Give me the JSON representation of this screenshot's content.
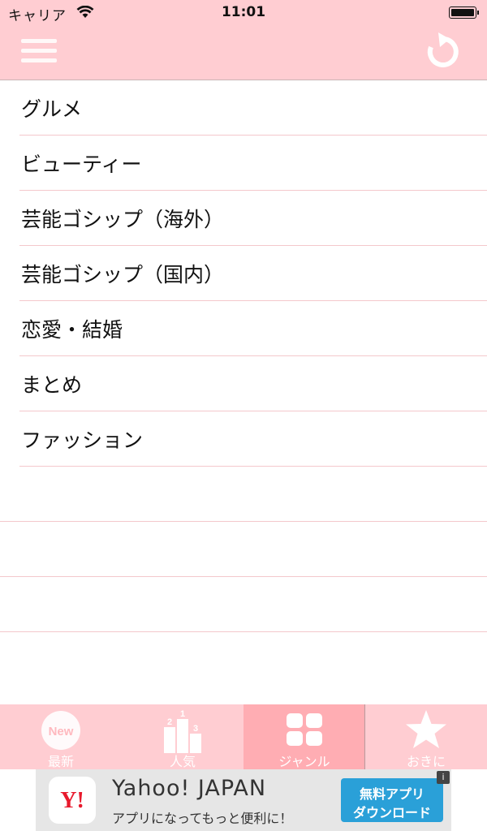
{
  "status_bar": {
    "carrier": "キャリア",
    "time": "11:01"
  },
  "nav": {
    "menu_icon": "hamburger-icon",
    "refresh_icon": "refresh-icon"
  },
  "genres": [
    {
      "label": "グルメ"
    },
    {
      "label": "ビューティー"
    },
    {
      "label": "芸能ゴシップ（海外）"
    },
    {
      "label": "芸能ゴシップ（国内）"
    },
    {
      "label": "恋愛・結婚"
    },
    {
      "label": "まとめ"
    },
    {
      "label": "ファッション"
    }
  ],
  "tabs": [
    {
      "label": "最新",
      "icon": "new-badge-icon",
      "badge": "New",
      "active": false
    },
    {
      "label": "人気",
      "icon": "podium-icon",
      "active": false
    },
    {
      "label": "ジャンル",
      "icon": "grid-icon",
      "active": true
    },
    {
      "label": "おきに",
      "icon": "star-icon",
      "active": false
    }
  ],
  "colors": {
    "accent": "#ffcdd2",
    "active_tab": "#ffadb3",
    "separator": "#f4c8cc"
  },
  "ad": {
    "logo_text": "Y!",
    "title": "Yahoo! JAPAN",
    "subtitle": "アプリになってもっと便利に！",
    "cta_line1": "無料アプリ",
    "cta_line2": "ダウンロード",
    "info": "i"
  }
}
